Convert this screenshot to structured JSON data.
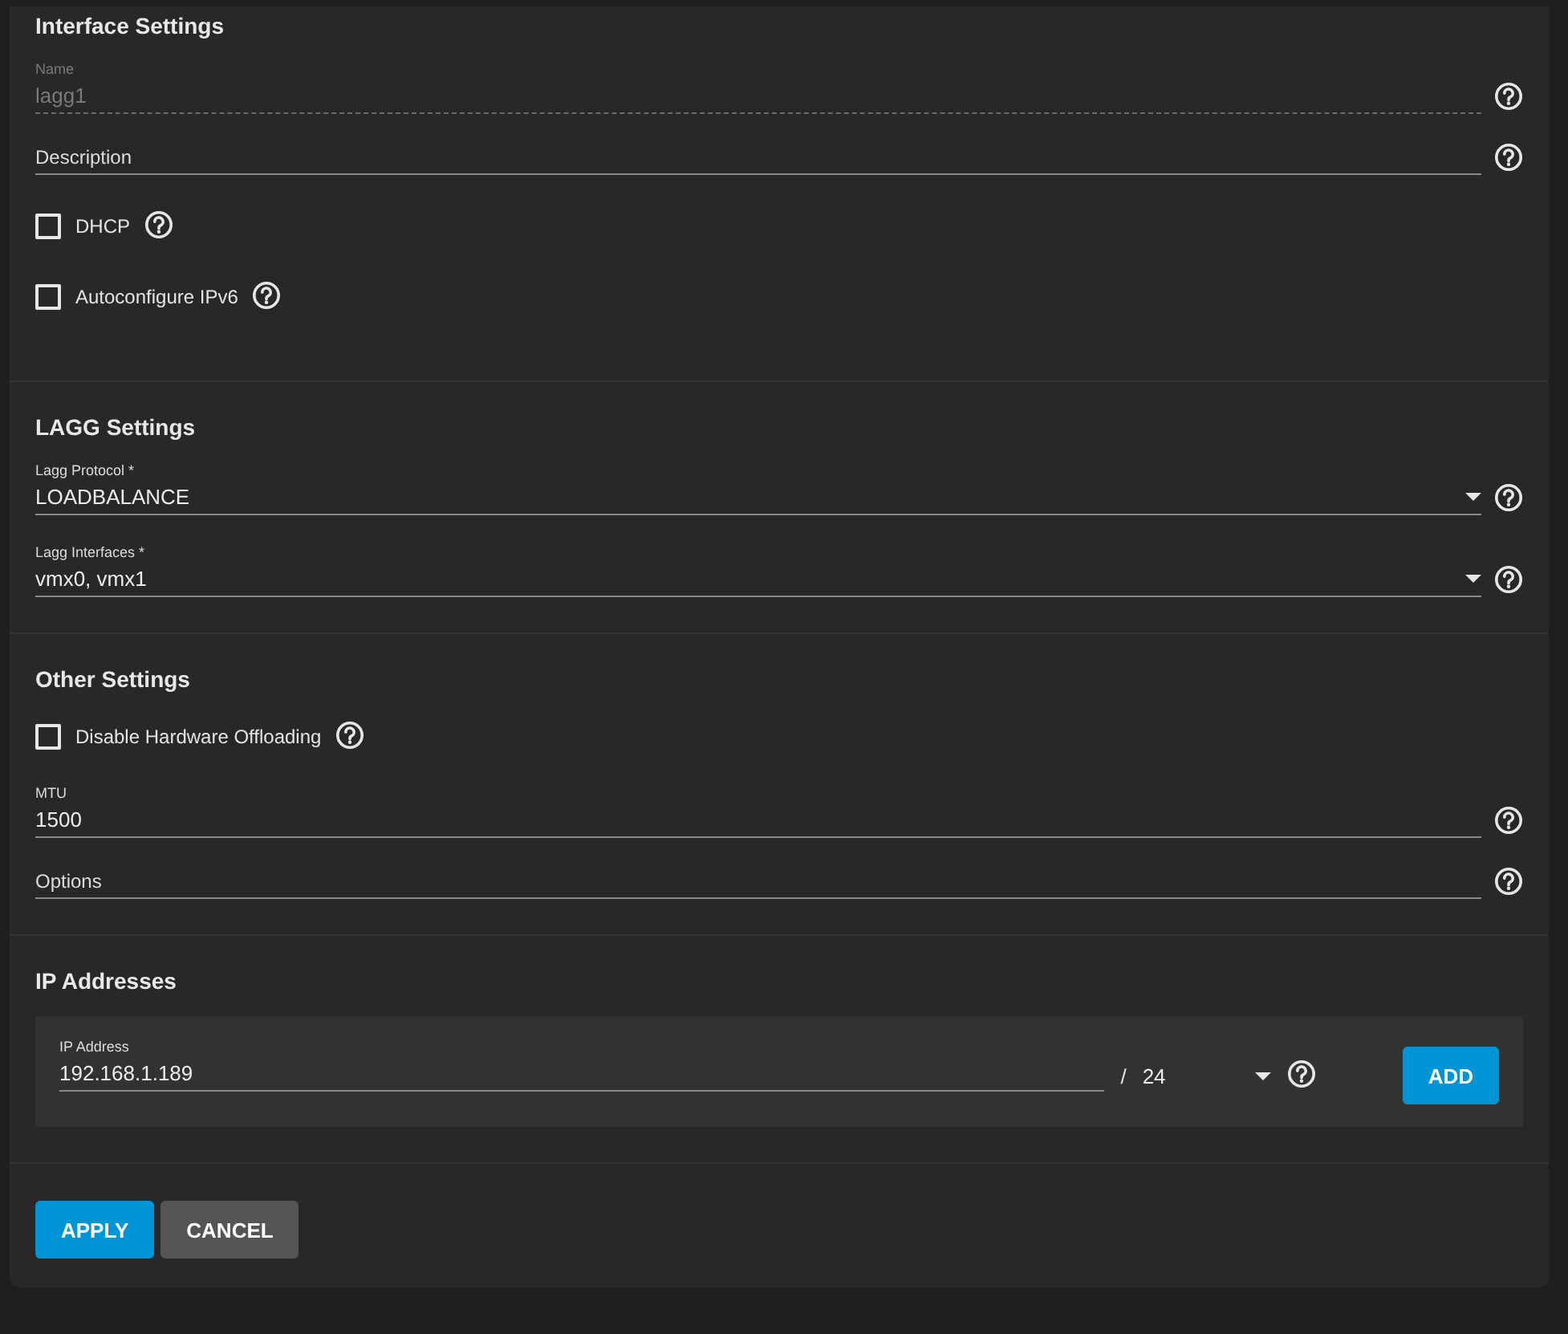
{
  "sections": [
    {
      "title": "Interface Settings",
      "fields": [
        {
          "kind": "text",
          "label": "Name",
          "value": "lagg1",
          "disabled": true,
          "help": true
        },
        {
          "kind": "text",
          "placeholder": "Description",
          "disabled": false,
          "help": true
        },
        {
          "kind": "checkbox",
          "label": "DHCP",
          "checked": false,
          "help": true
        },
        {
          "kind": "checkbox",
          "label": "Autoconfigure IPv6",
          "checked": false,
          "help": true
        }
      ]
    },
    {
      "title": "LAGG Settings",
      "fields": [
        {
          "kind": "select",
          "label": "Lagg Protocol *",
          "value": "LOADBALANCE",
          "help": true
        },
        {
          "kind": "select",
          "label": "Lagg Interfaces *",
          "value": "vmx0, vmx1",
          "help": true
        }
      ]
    },
    {
      "title": "Other Settings",
      "fields": [
        {
          "kind": "checkbox",
          "label": "Disable Hardware Offloading",
          "checked": false,
          "help": true
        },
        {
          "kind": "text",
          "label": "MTU",
          "value": "1500",
          "disabled": false,
          "help": true
        },
        {
          "kind": "text",
          "placeholder": "Options",
          "disabled": false,
          "help": true
        }
      ]
    },
    {
      "title": "IP Addresses",
      "fields": [
        {
          "kind": "ip",
          "label": "IP Address",
          "value": "192.168.1.189",
          "separator": "/",
          "netmask": "24",
          "help": true,
          "button": "ADD"
        }
      ]
    }
  ],
  "buttons": [
    {
      "label": "APPLY",
      "kind": "primary"
    },
    {
      "label": "CANCEL",
      "kind": "secondary"
    }
  ]
}
